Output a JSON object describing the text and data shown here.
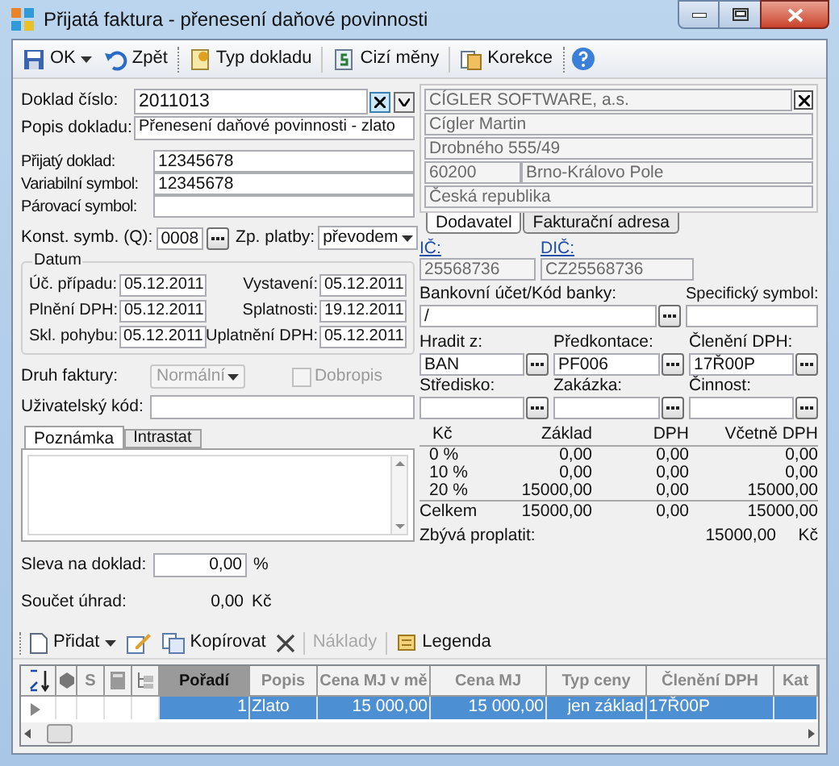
{
  "window": {
    "title": "Přijatá faktura - přenesení daňové povinnosti"
  },
  "toolbar": [
    {
      "kind": "save",
      "label": "OK"
    },
    {
      "kind": "undo",
      "label": "Zpět"
    },
    {
      "kind": "doctype",
      "label": "Typ dokladu"
    },
    {
      "kind": "currency",
      "label": "Cizí měny"
    },
    {
      "kind": "correction",
      "label": "Korekce"
    },
    {
      "kind": "help"
    }
  ],
  "doc_number": {
    "label": "Doklad číslo:",
    "value": "2011013"
  },
  "description": {
    "label": "Popis dokladu:",
    "value": "Přenesení daňové povinnosti - zlato"
  },
  "references": [
    {
      "label": "Přijatý doklad:",
      "value": "12345678"
    },
    {
      "label": "Variabilní symbol:",
      "value": "12345678"
    },
    {
      "label": "Párovací symbol:"
    }
  ],
  "const_symbol": {
    "label": "Konst. symb. (Q):",
    "value": "0008"
  },
  "payment": {
    "label": "Zp. platby:",
    "value": "převodem"
  },
  "dates": {
    "title": "Datum",
    "rows": [
      {
        "left_label": "Úč. případu:",
        "left_value": "05.12.2011",
        "right_label": "Vystavení:",
        "right_value": "05.12.2011"
      },
      {
        "left_label": "Plnění DPH:",
        "left_value": "05.12.2011",
        "right_label": "Splatnosti:",
        "right_value": "19.12.2011"
      },
      {
        "left_label": "Skl. pohybu:",
        "left_value": "05.12.2011",
        "right_label": "Uplatnění DPH:",
        "right_value": "05.12.2011"
      }
    ]
  },
  "invoice_type": {
    "label": "Druh faktury:",
    "value": "Normální",
    "disabled": true
  },
  "credit_note": {
    "label": "Dobropis",
    "checked": false,
    "disabled": true
  },
  "user_code": {
    "label": "Uživatelský kód:"
  },
  "note_tabs": [
    {
      "label": "Poznámka",
      "selected": true
    },
    {
      "label": "Intrastat",
      "selected": false
    }
  ],
  "discount": {
    "label": "Sleva na doklad:",
    "value": "0,00",
    "unit": "%"
  },
  "payments_total": {
    "label": "Součet úhrad:",
    "value": "0,00",
    "unit": "Kč"
  },
  "supplier": {
    "lines": [
      "CÍGLER SOFTWARE, a.s.",
      "Cígler Martin",
      "Drobného 555/49"
    ],
    "zip": "60200",
    "city": "Brno-Královo Pole",
    "country": "Česká republika"
  },
  "address_tabs": [
    {
      "label": "Dodavatel",
      "selected": true
    },
    {
      "label": "Fakturační adresa",
      "selected": false
    }
  ],
  "ids": [
    {
      "label": "IČ:",
      "value": "25568736"
    },
    {
      "label": "DIČ:",
      "value": "CZ25568736"
    }
  ],
  "bank": {
    "label": "Bankovní účet/Kód banky:",
    "value": "/"
  },
  "specific_symbol": {
    "label": "Specifický symbol:"
  },
  "accounting": [
    {
      "label": "Hradit z:",
      "value": "BAN"
    },
    {
      "label": "Předkontace:",
      "value": "PF006"
    },
    {
      "label": "Členění DPH:",
      "value": "17Ř00P"
    },
    {
      "label": "Středisko:"
    },
    {
      "label": "Zakázka:"
    },
    {
      "label": "Činnost:"
    }
  ],
  "vat_table": {
    "columns": [
      "Kč",
      "Základ",
      "DPH",
      "Včetně DPH"
    ],
    "rows": [
      [
        "0 %",
        "0,00",
        "0,00",
        "0,00"
      ],
      [
        "10 %",
        "0,00",
        "0,00",
        "0,00"
      ],
      [
        "20 %",
        "15000,00",
        "0,00",
        "15000,00"
      ]
    ],
    "total": [
      "Celkem",
      "15000,00",
      "0,00",
      "15000,00"
    ],
    "remaining": {
      "label": "Zbývá proplatit:",
      "value": "15000,00",
      "unit": "Kč"
    }
  },
  "items_toolbar": [
    {
      "kind": "add",
      "label": "Přidat",
      "disabled": false
    },
    {
      "kind": "edit",
      "disabled": false
    },
    {
      "kind": "copy",
      "label": "Kopírovat",
      "disabled": false
    },
    {
      "kind": "delete",
      "disabled": false
    },
    {
      "kind": "costs",
      "label": "Náklady",
      "disabled": true
    },
    {
      "kind": "legend",
      "label": "Legenda",
      "disabled": false
    }
  ],
  "grid": {
    "columns": [
      {
        "kind": "sort"
      },
      {
        "kind": "gem"
      },
      {
        "kind": "text",
        "label": "S",
        "selected": false
      },
      {
        "kind": "calc"
      },
      {
        "kind": "tree"
      },
      {
        "kind": "text",
        "label": "Pořadí",
        "selected": true
      },
      {
        "kind": "text",
        "label": "Popis",
        "selected": false
      },
      {
        "kind": "text",
        "label": "Cena MJ v mě",
        "selected": false
      },
      {
        "kind": "text",
        "label": "Cena MJ",
        "selected": false
      },
      {
        "kind": "text",
        "label": "Typ ceny",
        "selected": false
      },
      {
        "kind": "text",
        "label": "Členění DPH",
        "selected": false
      },
      {
        "kind": "text",
        "label": "Kat",
        "selected": false
      }
    ],
    "rows": [
      {
        "selected": true,
        "cells": [
          "",
          "",
          "",
          "",
          "",
          "1",
          "Zlato",
          "15 000,00",
          "15 000,00",
          "jen základ",
          "17Ř00P",
          ""
        ]
      }
    ]
  }
}
